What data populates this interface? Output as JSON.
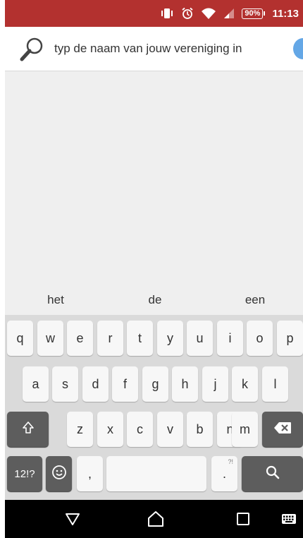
{
  "status_bar": {
    "battery_percent": "90%",
    "time": "11:13",
    "icons": [
      "vibrate-icon",
      "alarm-icon",
      "wifi-icon",
      "signal-icon",
      "battery-icon"
    ],
    "background_color": "#b3312f"
  },
  "search": {
    "placeholder": "typ de naam van jouw vereniging in",
    "value": "",
    "icon": "search-icon"
  },
  "suggestions": [
    "het",
    "de",
    "een"
  ],
  "keyboard": {
    "row1": [
      "q",
      "w",
      "e",
      "r",
      "t",
      "y",
      "u",
      "i",
      "o",
      "p"
    ],
    "row2": [
      "a",
      "s",
      "d",
      "f",
      "g",
      "h",
      "j",
      "k",
      "l"
    ],
    "row3": [
      "z",
      "x",
      "c",
      "v",
      "b",
      "n",
      "m"
    ],
    "symbols_label": "12!?",
    "comma": ",",
    "period": ".",
    "period_hint": "?!",
    "shift_icon": "shift-icon",
    "backspace_icon": "backspace-icon",
    "emoji_icon": "emoji-icon",
    "search_key_icon": "search-icon"
  },
  "nav_bar": {
    "icons": [
      "back-icon",
      "home-icon",
      "recents-icon",
      "keyboard-icon"
    ]
  }
}
